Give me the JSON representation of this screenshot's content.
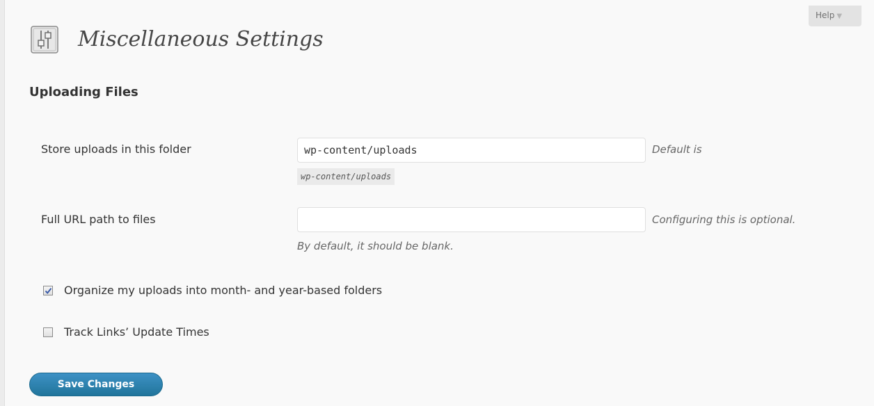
{
  "help": {
    "label": "Help",
    "arrow": "▼"
  },
  "page": {
    "title": "Miscellaneous Settings",
    "title_icon": "settings-sliders-icon"
  },
  "section": {
    "title": "Uploading Files"
  },
  "upload_folder": {
    "label": "Store uploads in this folder",
    "value": "wp-content/uploads",
    "description": "Default is",
    "default_code": "wp-content/uploads"
  },
  "url_path": {
    "label": "Full URL path to files",
    "value": "",
    "description": "Configuring this is optional.",
    "note": "By default, it should be blank."
  },
  "organize": {
    "label": "Organize my uploads into month- and year-based folders",
    "checked": true
  },
  "track_links": {
    "label": "Track Links’ Update Times",
    "checked": false
  },
  "save": {
    "label": "Save Changes"
  },
  "colors": {
    "background": "#f9f9f9",
    "button": "#21759b"
  }
}
